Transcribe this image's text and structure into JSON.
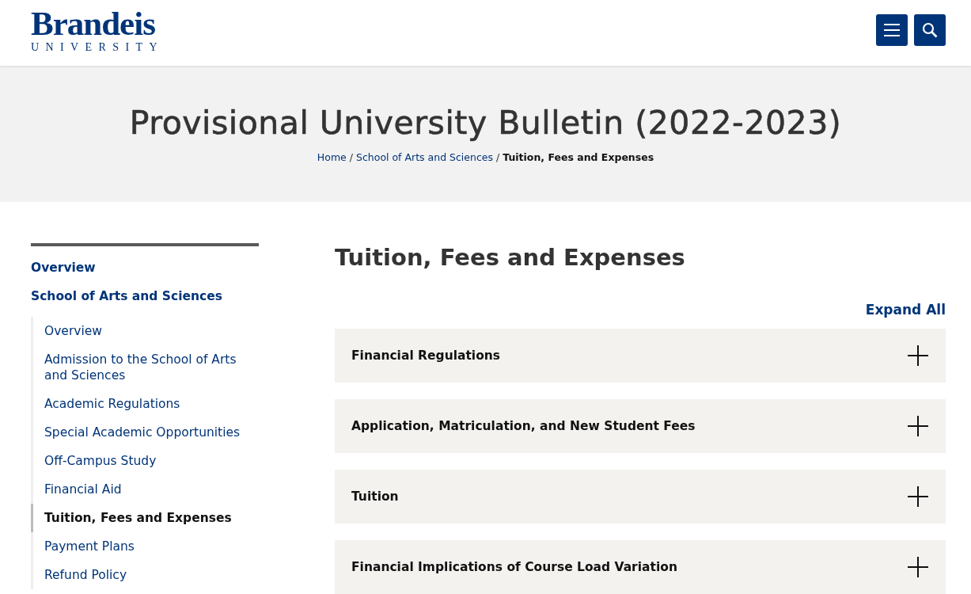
{
  "header": {
    "logo": {
      "wordmark": "Brandeis",
      "subtitle": "UNIVERSITY"
    }
  },
  "banner": {
    "title": "Provisional University Bulletin (2022-2023)",
    "breadcrumb_separator": "/",
    "breadcrumbs": [
      {
        "label": "Home",
        "current": false
      },
      {
        "label": "School of Arts and Sciences",
        "current": false
      },
      {
        "label": "Tuition, Fees and Expenses",
        "current": true
      }
    ]
  },
  "sidebar": {
    "items": [
      {
        "label": "Overview",
        "selected": false
      },
      {
        "label": "School of Arts and Sciences",
        "selected": false,
        "children": [
          {
            "label": "Overview",
            "selected": false
          },
          {
            "label": "Admission to the School of Arts and Sciences",
            "selected": false
          },
          {
            "label": "Academic Regulations",
            "selected": false
          },
          {
            "label": "Special Academic Opportunities",
            "selected": false
          },
          {
            "label": "Off-Campus Study",
            "selected": false
          },
          {
            "label": "Financial Aid",
            "selected": false
          },
          {
            "label": "Tuition, Fees and Expenses",
            "selected": true
          },
          {
            "label": "Payment Plans",
            "selected": false
          },
          {
            "label": "Refund Policy",
            "selected": false
          }
        ]
      }
    ]
  },
  "main": {
    "title": "Tuition, Fees and Expenses",
    "expand_all": "Expand All",
    "sections": [
      {
        "title": "Financial Regulations",
        "expanded": false
      },
      {
        "title": "Application, Matriculation, and New Student Fees",
        "expanded": false
      },
      {
        "title": "Tuition",
        "expanded": false
      },
      {
        "title": "Financial Implications of Course Load Variation",
        "expanded": false
      }
    ]
  }
}
